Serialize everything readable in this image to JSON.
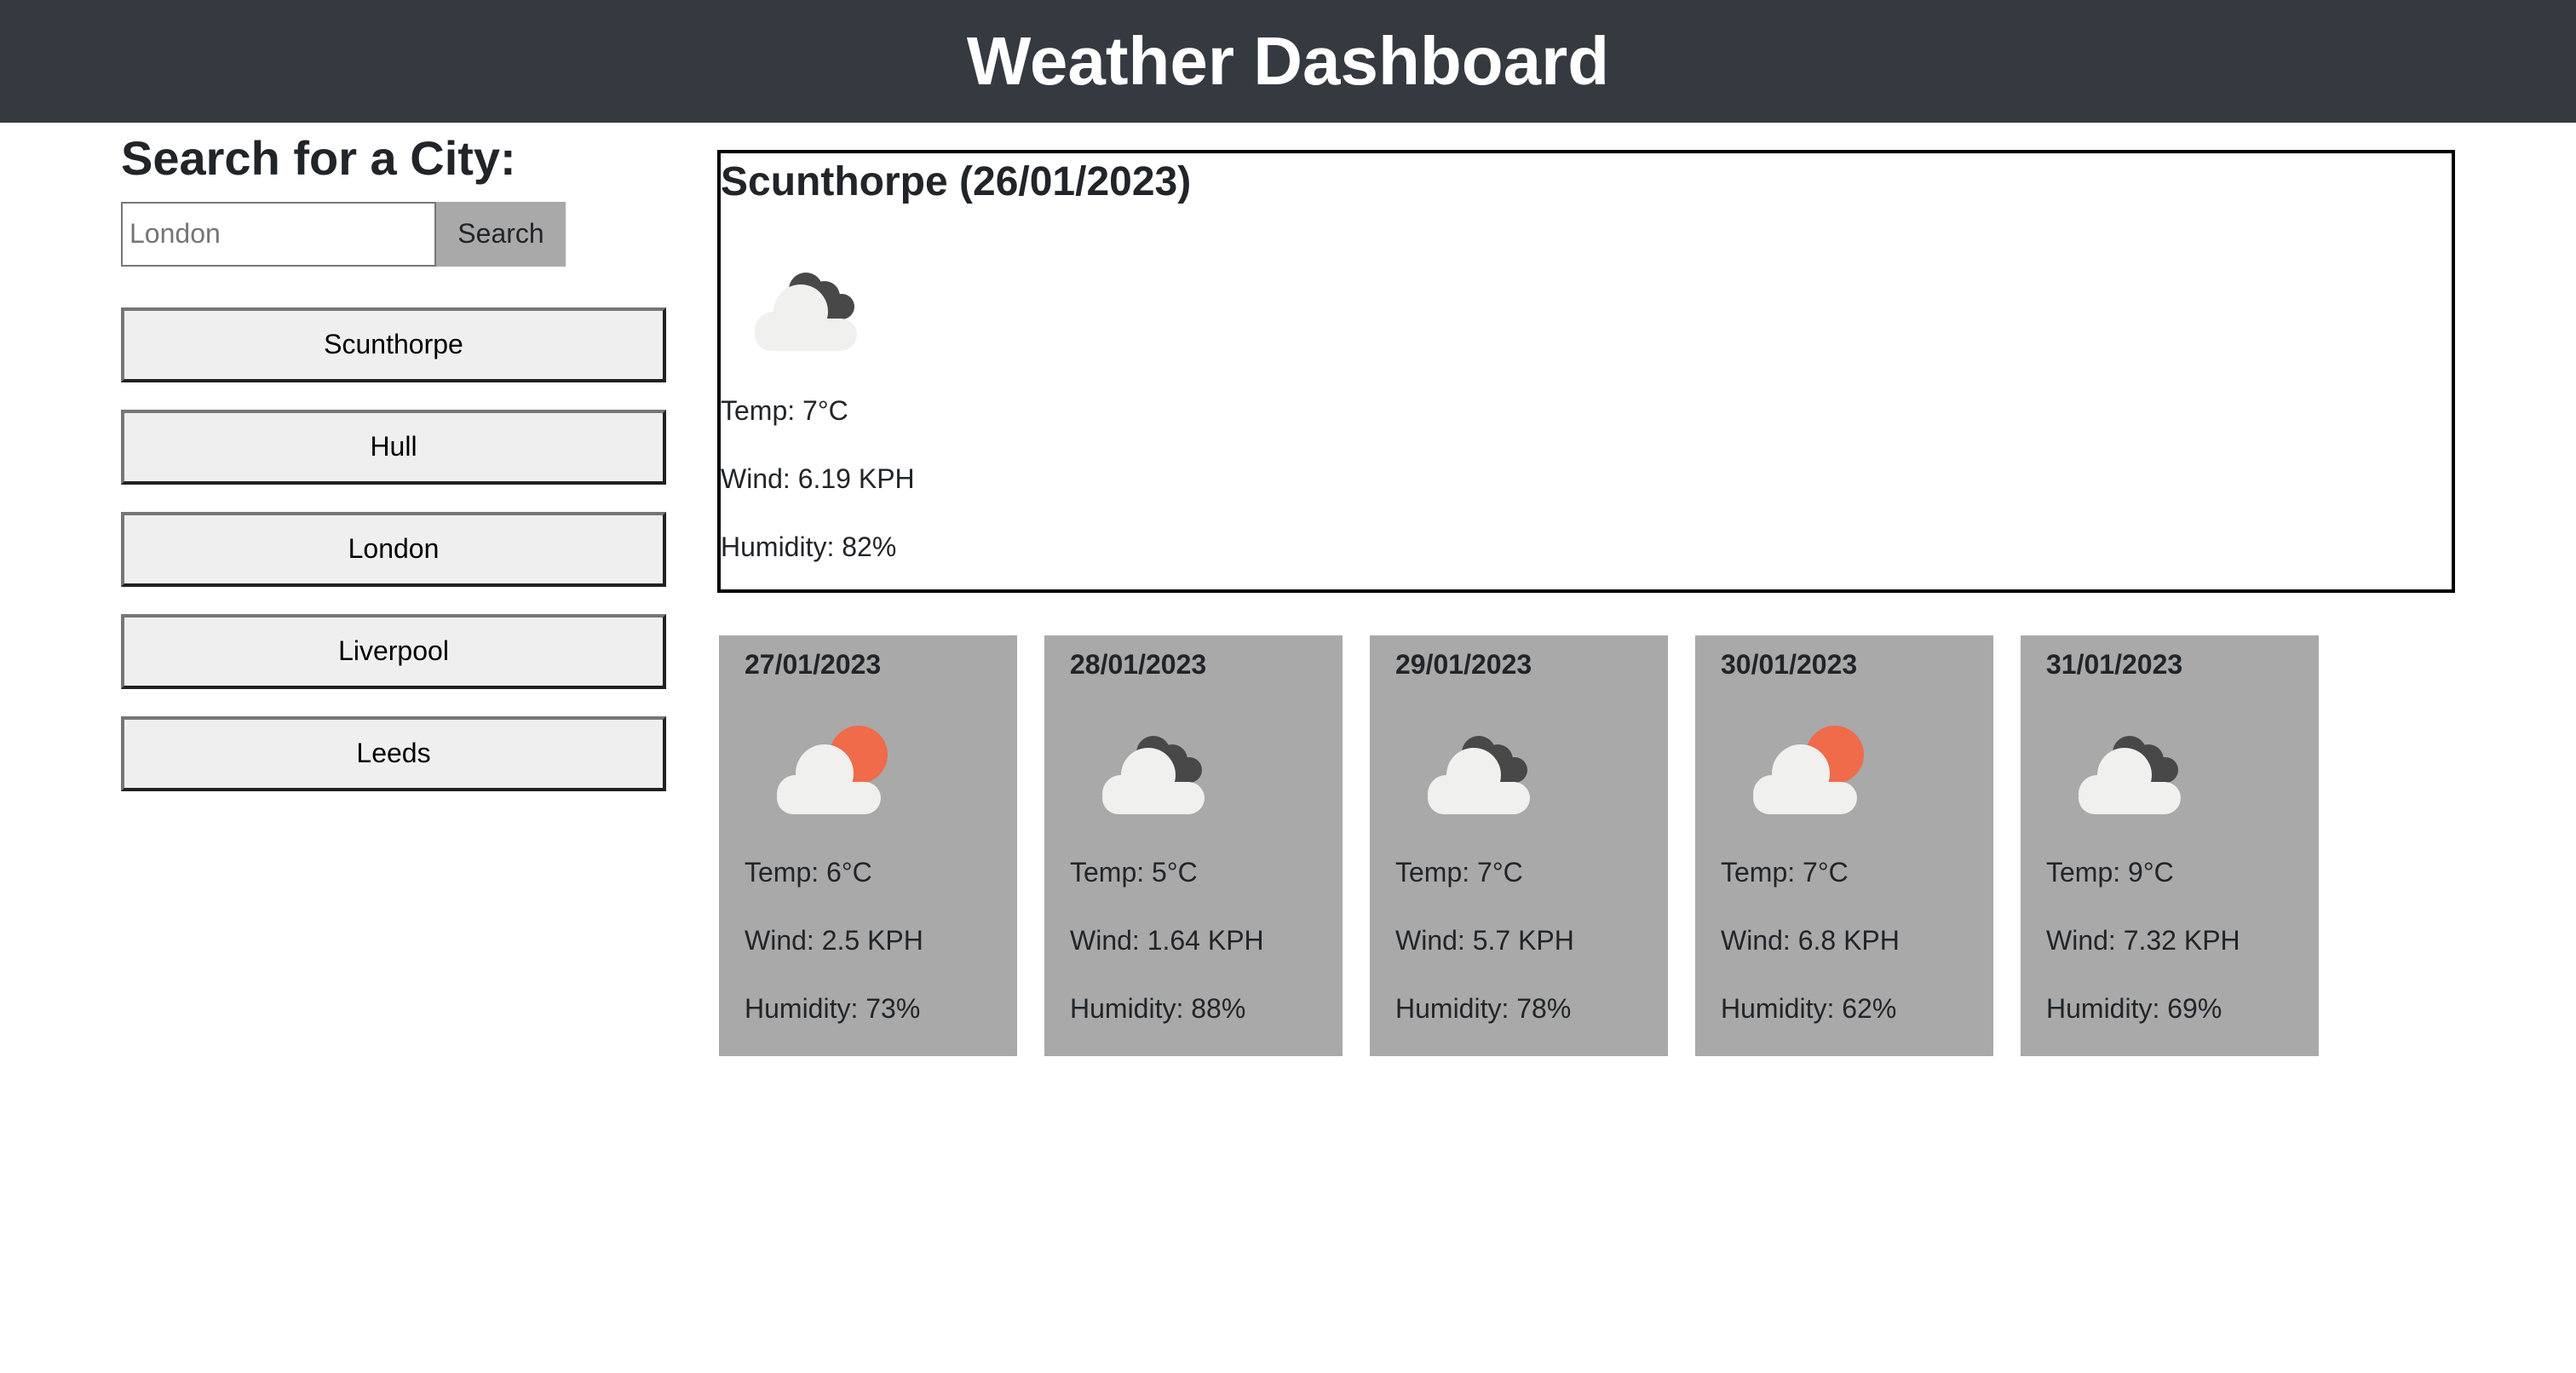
{
  "header": {
    "title": "Weather Dashboard"
  },
  "search": {
    "title": "Search for a City:",
    "placeholder": "London",
    "value": "",
    "button_label": "Search"
  },
  "history": [
    "Scunthorpe",
    "Hull",
    "London",
    "Liverpool",
    "Leeds"
  ],
  "current": {
    "title": "Scunthorpe (26/01/2023)",
    "icon": "cloudy-night-icon",
    "temp": "Temp: 7°C",
    "wind": "Wind: 6.19 KPH",
    "humidity": "Humidity: 82%"
  },
  "forecast": [
    {
      "date": "27/01/2023",
      "icon": "partly-cloudy-day-icon",
      "temp": "Temp: 6°C",
      "wind": "Wind: 2.5 KPH",
      "humidity": "Humidity: 73%"
    },
    {
      "date": "28/01/2023",
      "icon": "cloudy-night-icon",
      "temp": "Temp: 5°C",
      "wind": "Wind: 1.64 KPH",
      "humidity": "Humidity: 88%"
    },
    {
      "date": "29/01/2023",
      "icon": "cloudy-night-icon",
      "temp": "Temp: 7°C",
      "wind": "Wind: 5.7 KPH",
      "humidity": "Humidity: 78%"
    },
    {
      "date": "30/01/2023",
      "icon": "partly-cloudy-day-icon",
      "temp": "Temp: 7°C",
      "wind": "Wind: 6.8 KPH",
      "humidity": "Humidity: 62%"
    },
    {
      "date": "31/01/2023",
      "icon": "cloudy-night-icon",
      "temp": "Temp: 9°C",
      "wind": "Wind: 7.32 KPH",
      "humidity": "Humidity: 69%"
    }
  ],
  "colors": {
    "header_bg": "#343a40",
    "forecast_card_bg": "#a9a9a9",
    "history_button_bg": "#efefef",
    "sun": "#ef6b4a",
    "dark_cloud": "#484848",
    "light_cloud": "#f0f0ee"
  }
}
